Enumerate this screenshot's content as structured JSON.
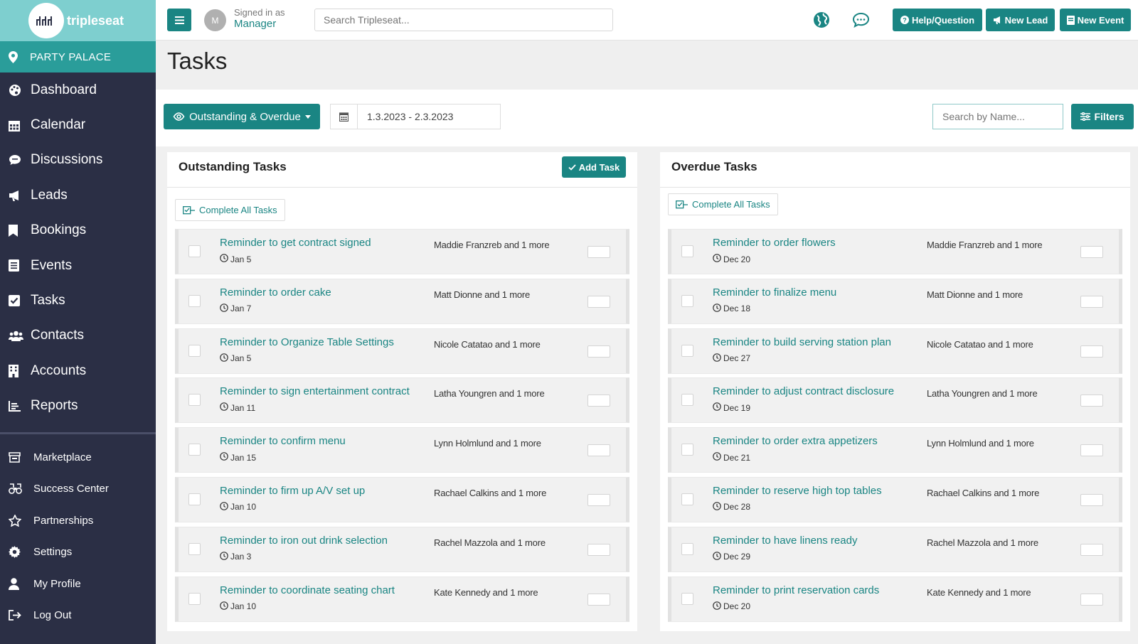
{
  "brand": {
    "logo_text": "tripleseat",
    "venue": "PARTY PALACE"
  },
  "sidebar": {
    "main_items": [
      {
        "label": "Dashboard",
        "icon": "palette-icon"
      },
      {
        "label": "Calendar",
        "icon": "calendar-icon"
      },
      {
        "label": "Discussions",
        "icon": "chat-icon"
      },
      {
        "label": "Leads",
        "icon": "megaphone-icon"
      },
      {
        "label": "Bookings",
        "icon": "bookmark-icon"
      },
      {
        "label": "Events",
        "icon": "list-icon"
      },
      {
        "label": "Tasks",
        "icon": "check-square-icon"
      },
      {
        "label": "Contacts",
        "icon": "users-icon"
      },
      {
        "label": "Accounts",
        "icon": "building-icon"
      },
      {
        "label": "Reports",
        "icon": "bar-chart-icon"
      }
    ],
    "secondary_items": [
      {
        "label": "Marketplace",
        "icon": "store-icon"
      },
      {
        "label": "Success Center",
        "icon": "binoculars-icon"
      },
      {
        "label": "Partnerships",
        "icon": "star-icon"
      },
      {
        "label": "Settings",
        "icon": "gear-icon"
      },
      {
        "label": "My Profile",
        "icon": "user-icon"
      },
      {
        "label": "Log Out",
        "icon": "logout-icon"
      }
    ]
  },
  "topbar": {
    "avatar_initial": "M",
    "signed_in_label": "Signed in as",
    "role": "Manager",
    "search_placeholder": "Search Tripleseat...",
    "help_label": "Help/Question",
    "new_lead_label": "New Lead",
    "new_event_label": "New Event"
  },
  "page": {
    "title": "Tasks"
  },
  "filters": {
    "status_label": "Outstanding & Overdue",
    "date_range": "1.3.2023 - 2.3.2023",
    "name_search_placeholder": "Search by Name...",
    "filters_label": "Filters"
  },
  "outstanding": {
    "title": "Outstanding Tasks",
    "add_task_label": "Add Task",
    "complete_all_label": "Complete All Tasks",
    "tasks": [
      {
        "title": "Reminder to get contract signed",
        "date": "Jan 5",
        "assignee": "Maddie Franzreb and 1 more"
      },
      {
        "title": "Reminder to order cake",
        "date": "Jan 7",
        "assignee": "Matt Dionne and 1 more"
      },
      {
        "title": "Reminder to Organize Table Settings",
        "date": "Jan 5",
        "assignee": "Nicole Catatao and 1 more"
      },
      {
        "title": "Reminder to sign entertainment contract",
        "date": "Jan 11",
        "assignee": "Latha Youngren and 1 more"
      },
      {
        "title": "Reminder to confirm menu",
        "date": "Jan 15",
        "assignee": "Lynn Holmlund and 1 more"
      },
      {
        "title": "Reminder to firm up A/V set up",
        "date": "Jan 10",
        "assignee": "Rachael Calkins and 1 more"
      },
      {
        "title": "Reminder to iron out drink selection",
        "date": "Jan 3",
        "assignee": "Rachel Mazzola and 1 more"
      },
      {
        "title": "Reminder to coordinate seating chart",
        "date": "Jan 10",
        "assignee": "Kate Kennedy and 1 more"
      }
    ]
  },
  "overdue": {
    "title": "Overdue Tasks",
    "complete_all_label": "Complete All Tasks",
    "tasks": [
      {
        "title": "Reminder to order flowers",
        "date": "Dec 20",
        "assignee": "Maddie Franzreb and 1 more"
      },
      {
        "title": "Reminder to finalize menu",
        "date": "Dec 18",
        "assignee": "Matt Dionne and 1 more"
      },
      {
        "title": "Reminder to build serving station plan",
        "date": "Dec 27",
        "assignee": "Nicole Catatao and 1 more"
      },
      {
        "title": "Reminder to adjust contract disclosure",
        "date": "Dec 19",
        "assignee": "Latha Youngren and 1 more"
      },
      {
        "title": "Reminder to order extra appetizers",
        "date": "Dec 21",
        "assignee": "Lynn Holmlund and 1 more"
      },
      {
        "title": "Reminder to reserve high top tables",
        "date": "Dec 28",
        "assignee": "Rachael Calkins and 1 more"
      },
      {
        "title": "Reminder to have linens ready",
        "date": "Dec 29",
        "assignee": "Rachel Mazzola and 1 more"
      },
      {
        "title": "Reminder to print reservation cards",
        "date": "Dec 20",
        "assignee": "Kate Kennedy and 1 more"
      }
    ]
  },
  "colors": {
    "accent": "#1a8583",
    "sidebar_bg": "#2b2f45",
    "logo_bg": "#7ecfcf",
    "venue_bg": "#2a9d9a"
  }
}
